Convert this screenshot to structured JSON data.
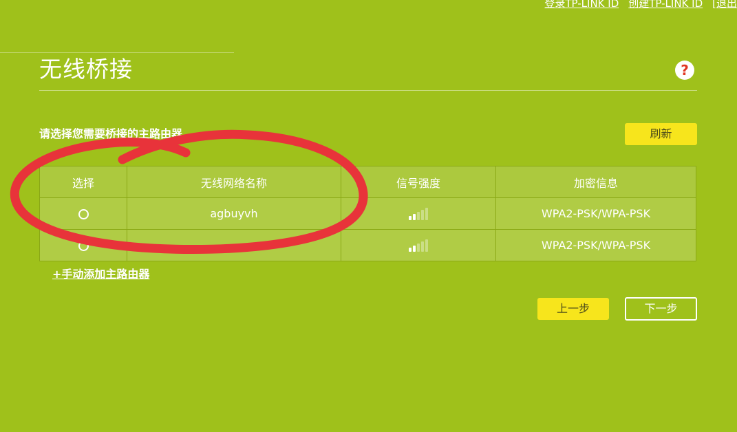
{
  "topbar": {
    "login_label": "登录TP-LINK ID",
    "create_label": "创建TP-LINK ID",
    "logout_label": "[退出"
  },
  "page": {
    "title": "无线桥接",
    "help_label": "?",
    "subtitle": "请选择您需要桥接的主路由器",
    "refresh_label": "刷新"
  },
  "table": {
    "headers": [
      "选择",
      "无线网络名称",
      "信号强度",
      "加密信息"
    ],
    "rows": [
      {
        "ssid": "agbuyvh",
        "signal_bars": 2,
        "security": "WPA2-PSK/WPA-PSK"
      },
      {
        "ssid": "",
        "signal_bars": 2,
        "security": "WPA2-PSK/WPA-PSK"
      }
    ]
  },
  "actions": {
    "add_router_label": "+手动添加主路由器",
    "prev_label": "上一步",
    "next_label": "下一步"
  },
  "colors": {
    "background": "#9fc11b",
    "button_yellow": "#f7e51c",
    "annotation_red": "#e8333a"
  }
}
